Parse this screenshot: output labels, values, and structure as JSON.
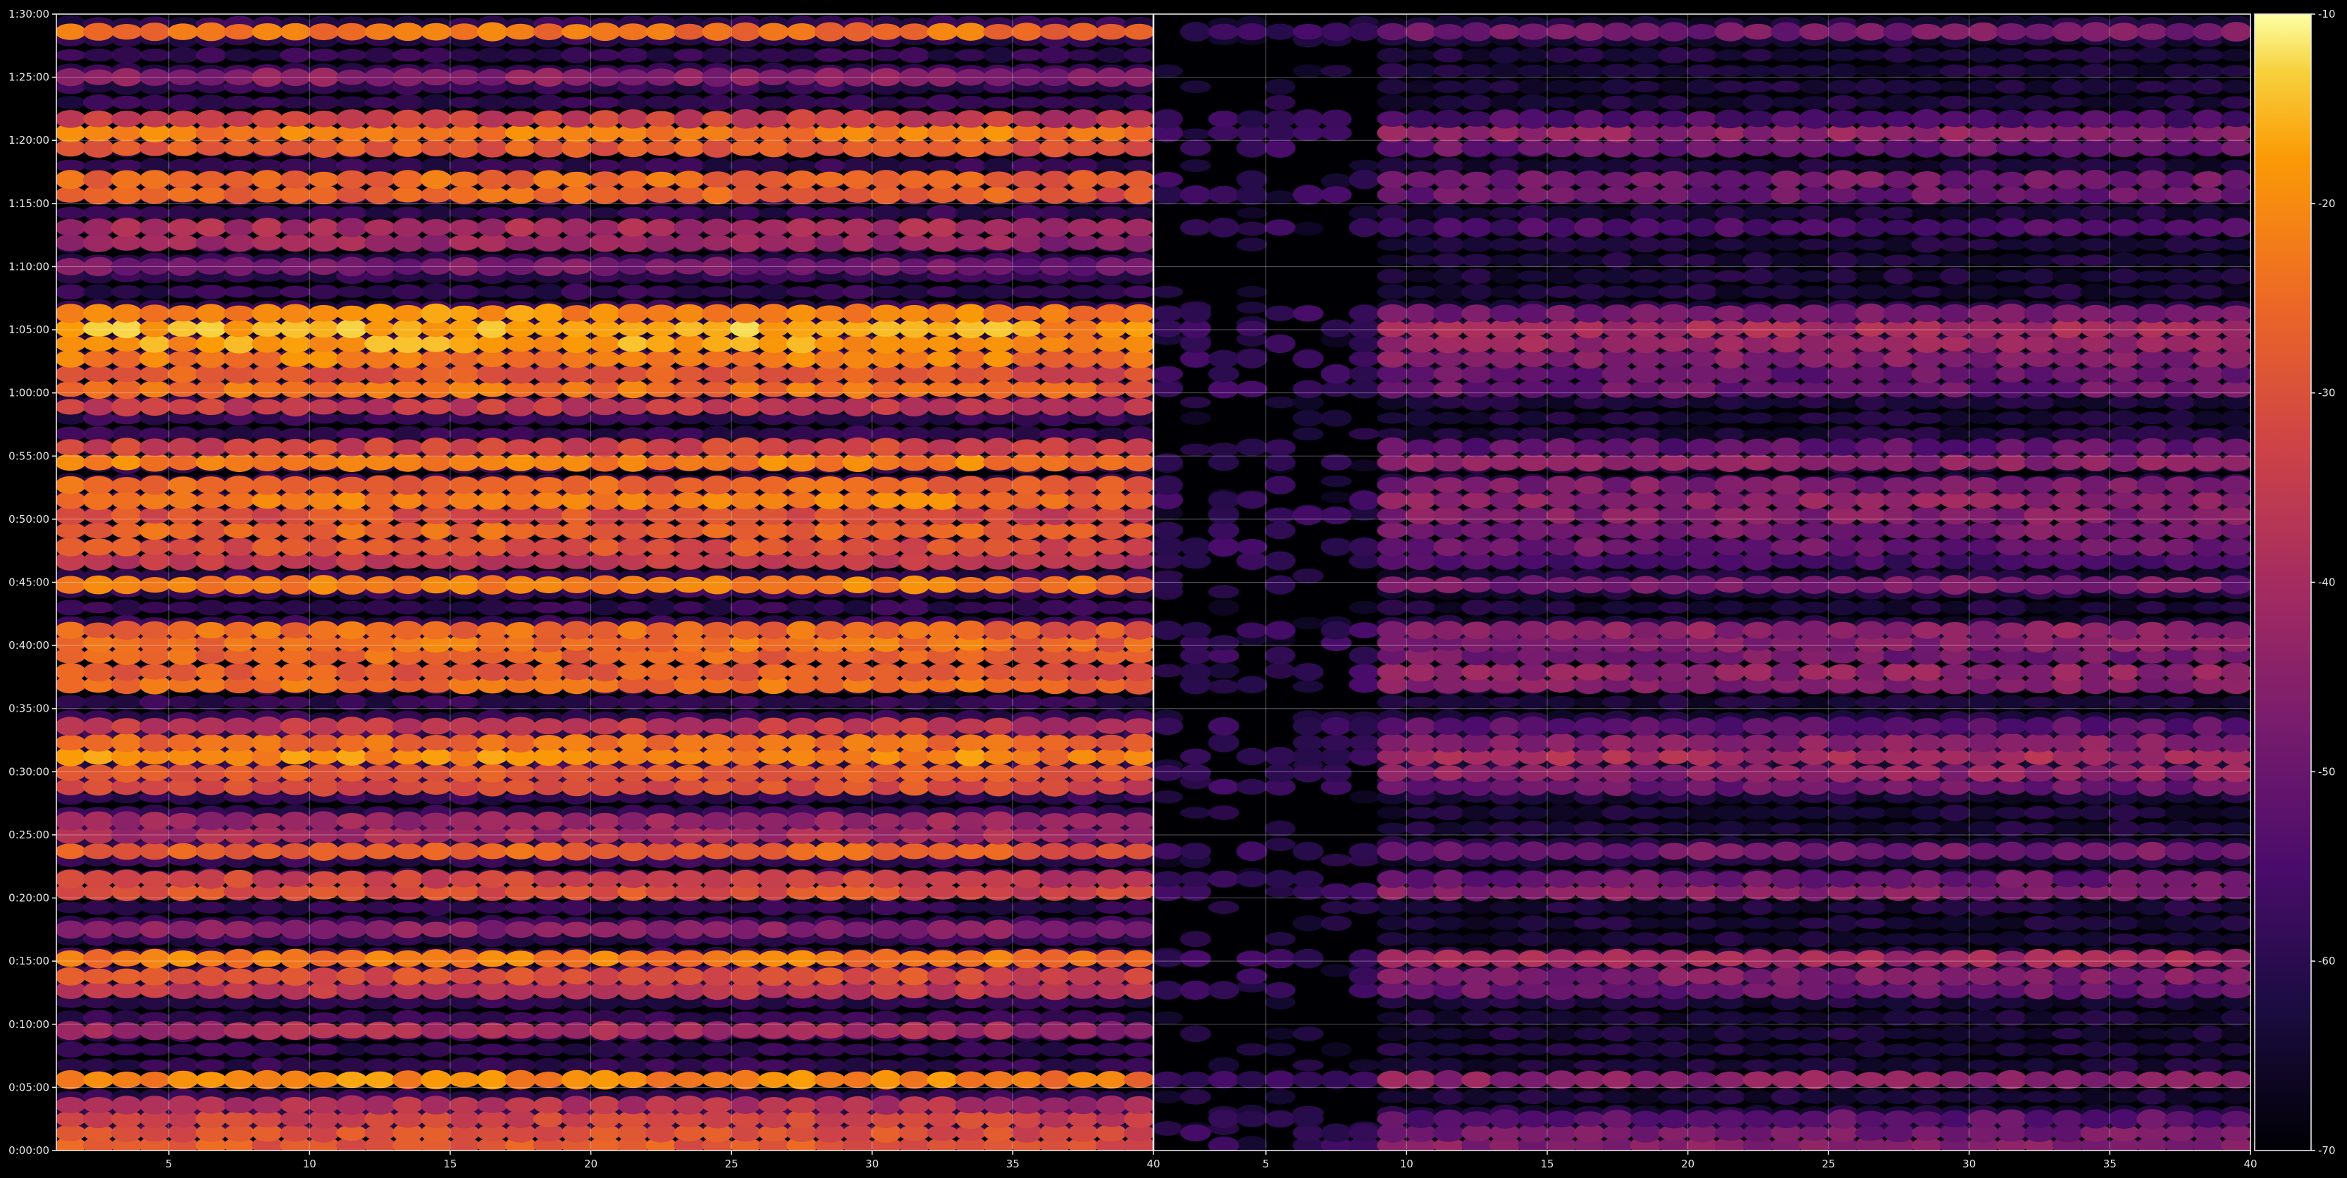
{
  "chart_data": {
    "type": "heatmap",
    "description_free": true,
    "colormap": "inferno",
    "background_color": "#000000",
    "grid": true,
    "colorbar": {
      "placement": "right",
      "min": -70,
      "max": -10,
      "ticks": [
        -10,
        -20,
        -30,
        -40,
        -50,
        -60,
        -70
      ]
    },
    "y_axis": {
      "min_minutes": 0,
      "max_minutes": 90,
      "tick_minutes": [
        0,
        5,
        10,
        15,
        20,
        25,
        30,
        35,
        40,
        45,
        50,
        55,
        60,
        65,
        70,
        75,
        80,
        85,
        90
      ],
      "tick_labels": [
        "0:00:00",
        "0:05:00",
        "0:10:00",
        "0:15:00",
        "0:20:00",
        "0:25:00",
        "0:30:00",
        "0:35:00",
        "0:40:00",
        "0:45:00",
        "0:50:00",
        "0:55:00",
        "1:00:00",
        "1:05:00",
        "1:10:00",
        "1:15:00",
        "1:20:00",
        "1:25:00",
        "1:30:00"
      ]
    },
    "panels": [
      {
        "x_min": 1,
        "x_max": 40,
        "x_ticks": [
          5,
          10,
          15,
          20,
          25,
          30,
          35,
          40
        ],
        "x_tick_labels": [
          "5",
          "10",
          "15",
          "20",
          "25",
          "30",
          "35",
          "40"
        ],
        "column_count": 39,
        "column_first_x": 1.5,
        "left_onset_column": 0,
        "left_onset_db": 0,
        "bands": [
          {
            "t": 0.4,
            "db": -28
          },
          {
            "t": 1.4,
            "db": -30
          },
          {
            "t": 2.5,
            "db": -33
          },
          {
            "t": 3.6,
            "db": -38
          },
          {
            "t": 5.6,
            "db": -20
          },
          {
            "t": 9.5,
            "db": -40
          },
          {
            "t": 12.7,
            "db": -36
          },
          {
            "t": 13.8,
            "db": -30
          },
          {
            "t": 15.2,
            "db": -22
          },
          {
            "t": 17.5,
            "db": -45
          },
          {
            "t": 20.5,
            "db": -30
          },
          {
            "t": 21.5,
            "db": -33
          },
          {
            "t": 23.7,
            "db": -26
          },
          {
            "t": 25.0,
            "db": -40
          },
          {
            "t": 26.1,
            "db": -42
          },
          {
            "t": 28.8,
            "db": -30
          },
          {
            "t": 29.9,
            "db": -28
          },
          {
            "t": 31.2,
            "db": -20
          },
          {
            "t": 32.3,
            "db": -25
          },
          {
            "t": 33.6,
            "db": -36
          },
          {
            "t": 36.9,
            "db": -24
          },
          {
            "t": 37.9,
            "db": -28
          },
          {
            "t": 39.2,
            "db": -26
          },
          {
            "t": 40.2,
            "db": -24
          },
          {
            "t": 41.2,
            "db": -25
          },
          {
            "t": 44.8,
            "db": -22
          },
          {
            "t": 46.7,
            "db": -36
          },
          {
            "t": 47.8,
            "db": -30
          },
          {
            "t": 49.1,
            "db": -26
          },
          {
            "t": 50.3,
            "db": -30
          },
          {
            "t": 51.5,
            "db": -22
          },
          {
            "t": 52.7,
            "db": -26
          },
          {
            "t": 54.5,
            "db": -22
          },
          {
            "t": 55.7,
            "db": -33
          },
          {
            "t": 58.9,
            "db": -35
          },
          {
            "t": 60.3,
            "db": -24
          },
          {
            "t": 61.5,
            "db": -28
          },
          {
            "t": 62.7,
            "db": -22
          },
          {
            "t": 63.9,
            "db": -18
          },
          {
            "t": 65.1,
            "db": -16
          },
          {
            "t": 66.3,
            "db": -20
          },
          {
            "t": 70.0,
            "db": -48
          },
          {
            "t": 71.9,
            "db": -42
          },
          {
            "t": 73.1,
            "db": -40
          },
          {
            "t": 75.7,
            "db": -26
          },
          {
            "t": 76.9,
            "db": -25
          },
          {
            "t": 79.4,
            "db": -28
          },
          {
            "t": 80.6,
            "db": -22
          },
          {
            "t": 81.7,
            "db": -34
          },
          {
            "t": 85.0,
            "db": -45
          },
          {
            "t": 88.6,
            "db": -24
          }
        ]
      },
      {
        "x_min": 1,
        "x_max": 40,
        "x_ticks": [
          5,
          10,
          15,
          20,
          25,
          30,
          35,
          40
        ],
        "x_tick_labels": [
          "5",
          "10",
          "15",
          "20",
          "25",
          "30",
          "35",
          "40"
        ],
        "column_count": 39,
        "column_first_x": 1.5,
        "left_onset_column": 8,
        "left_onset_db": -58,
        "bands": [
          {
            "t": 0.4,
            "db": -46
          },
          {
            "t": 1.4,
            "db": -48
          },
          {
            "t": 2.5,
            "db": -52
          },
          {
            "t": 5.6,
            "db": -44
          },
          {
            "t": 12.7,
            "db": -50
          },
          {
            "t": 13.8,
            "db": -47
          },
          {
            "t": 15.2,
            "db": -40
          },
          {
            "t": 20.5,
            "db": -46
          },
          {
            "t": 21.5,
            "db": -50
          },
          {
            "t": 23.7,
            "db": -48
          },
          {
            "t": 28.8,
            "db": -50
          },
          {
            "t": 29.9,
            "db": -44
          },
          {
            "t": 31.2,
            "db": -40
          },
          {
            "t": 32.3,
            "db": -45
          },
          {
            "t": 33.6,
            "db": -52
          },
          {
            "t": 36.9,
            "db": -46
          },
          {
            "t": 37.9,
            "db": -44
          },
          {
            "t": 39.2,
            "db": -48
          },
          {
            "t": 40.2,
            "db": -46
          },
          {
            "t": 41.2,
            "db": -44
          },
          {
            "t": 44.8,
            "db": -48
          },
          {
            "t": 46.7,
            "db": -56
          },
          {
            "t": 47.8,
            "db": -50
          },
          {
            "t": 49.1,
            "db": -48
          },
          {
            "t": 50.3,
            "db": -46
          },
          {
            "t": 51.5,
            "db": -44
          },
          {
            "t": 52.7,
            "db": -47
          },
          {
            "t": 54.5,
            "db": -45
          },
          {
            "t": 55.7,
            "db": -52
          },
          {
            "t": 60.3,
            "db": -50
          },
          {
            "t": 61.5,
            "db": -50
          },
          {
            "t": 62.7,
            "db": -46
          },
          {
            "t": 63.9,
            "db": -42
          },
          {
            "t": 65.1,
            "db": -40
          },
          {
            "t": 66.3,
            "db": -48
          },
          {
            "t": 73.1,
            "db": -55
          },
          {
            "t": 75.7,
            "db": -50
          },
          {
            "t": 76.9,
            "db": -48
          },
          {
            "t": 79.4,
            "db": -50
          },
          {
            "t": 80.6,
            "db": -44
          },
          {
            "t": 81.7,
            "db": -55
          },
          {
            "t": 88.6,
            "db": -48
          }
        ]
      }
    ]
  }
}
